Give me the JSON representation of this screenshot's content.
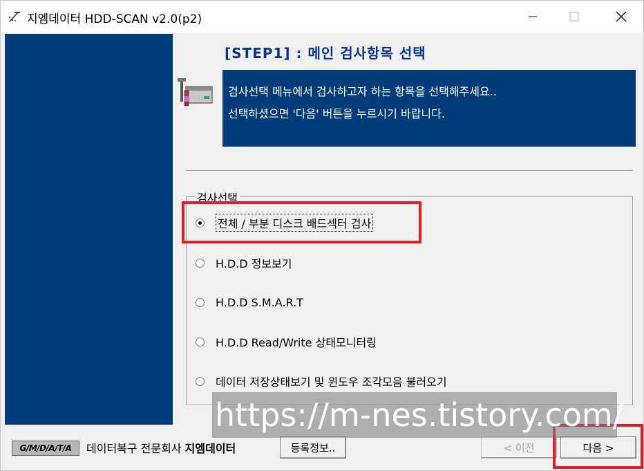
{
  "window": {
    "title": "지엠데이터 HDD-SCAN v2.0(p2)"
  },
  "header": {
    "step_title": "[STEP1] :  메인 검사항목 선택",
    "info_lines": [
      "검사선택 메뉴에서 검사하고자 하는 항목을 선택해주세요..",
      "선택하셨으면  '다음' 버튼을 누르시기 바랍니다."
    ]
  },
  "group": {
    "legend": "검사선택",
    "options": [
      {
        "label": "전체 / 부분 디스크 배드섹터 검사",
        "checked": true
      },
      {
        "label": "H.D.D 정보보기",
        "checked": false
      },
      {
        "label": "H.D.D S.M.A.R.T",
        "checked": false
      },
      {
        "label": "H.D.D Read/Write 상태모니터링",
        "checked": false
      },
      {
        "label": "데이터 저장상태보기 및 윈도우 조각모음 불러오기",
        "checked": false
      }
    ]
  },
  "footer": {
    "logo_text": "G/M/D/A/T/A",
    "company_prefix": "데이터복구 전문회사 ",
    "company_name": "지엠데이터",
    "register_button": "등록정보..",
    "prev_button": "< 이전",
    "next_button": "다음 >"
  },
  "watermark": "https://m-nes.tistory.com/",
  "colors": {
    "panel_blue": "#003c7a",
    "title_blue": "#07328e",
    "highlight_red": "#e11d24"
  }
}
